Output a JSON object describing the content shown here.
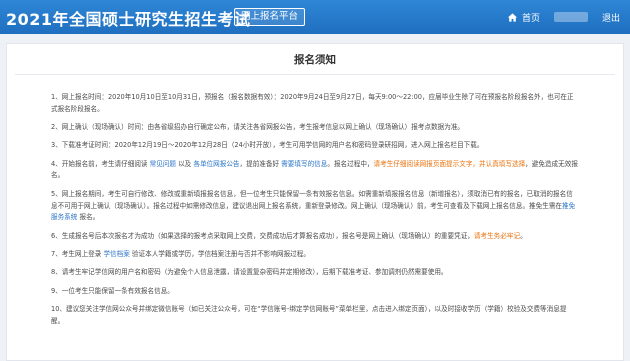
{
  "header": {
    "title": "2021年全国硕士研究生招生考试",
    "platform": "网上报名平台",
    "home_label": "首页",
    "logout_label": "退出"
  },
  "panel": {
    "title": "报名须知"
  },
  "notices": [
    {
      "parts": [
        {
          "text": "1、网上报名时间：2020年10月10日至10月31日，预报名（报名数据有效）：2020年9月24日至9月27日，每天9:00～22:00，应届毕业生除了可在预报名阶段报名外，也可在正式报名阶段报名。"
        }
      ]
    },
    {
      "parts": [
        {
          "text": "2、网上确认（现场确认）时间：由各省级招办自行确定公布，请关注各省网报公告，考生报考信息以网上确认（现场确认）报考点数据为准。"
        }
      ]
    },
    {
      "parts": [
        {
          "text": "3、下载准考证时间：2020年12月19日～2020年12月28日（24小时开放），考生可用学信网的用户名和密码登录研招网，进入网上报名栏目下载。"
        }
      ]
    },
    {
      "parts": [
        {
          "text": "4、开始报名前，考生请仔细阅读 "
        },
        {
          "text": "常见问题",
          "style": "blue"
        },
        {
          "text": " 以及 "
        },
        {
          "text": "各单位网报公告",
          "style": "blue"
        },
        {
          "text": "，提前准备好 "
        },
        {
          "text": "需要填写的信息",
          "style": "blue"
        },
        {
          "text": "。报名过程中，"
        },
        {
          "text": "请考生仔细阅读网报页面提示文字，并认真填写选择",
          "style": "orange"
        },
        {
          "text": "，避免造成无效报名。"
        }
      ]
    },
    {
      "parts": [
        {
          "text": "5、网上报名期间，考生可自行修改、修改或重新填报报名信息，但一位考生只能保留一条有效报名信息。如需重新填报报名信息（新增报名），须取消已有的报名，已取消的报名信息不可用于网上确认（现场确认）。报名过程中如需修改信息，建议退出网上报名系统，重新登录修改。网上确认（现场确认）前，考生可查看及下载网上报名信息。推免生需在"
        },
        {
          "text": "推免服务系统",
          "style": "blue"
        },
        {
          "text": " 报名。"
        }
      ]
    },
    {
      "parts": [
        {
          "text": "6、生成报名号后本次报名才为成功（如果选择的报考点采取网上交费，交费成功后才算报名成功），报名号是网上确认（现场确认）的重要凭证，"
        },
        {
          "text": "请考生务必牢记",
          "style": "orange"
        },
        {
          "text": "。"
        }
      ]
    },
    {
      "parts": [
        {
          "text": "7、考生网上登录 "
        },
        {
          "text": "学信档案",
          "style": "blue"
        },
        {
          "text": " 验证本人学籍或学历，学信档案注册与否并不影响网报过程。"
        }
      ]
    },
    {
      "parts": [
        {
          "text": "8、请考生牢记学信网的用户名和密码（为避免个人信息泄露，请设置复杂密码并定期修改），后期下载准考证、参加调剂仍然需要使用。"
        }
      ]
    },
    {
      "parts": [
        {
          "text": "9、一位考生只能保留一条有效报名信息。"
        }
      ]
    },
    {
      "parts": [
        {
          "text": "10、建议您关注学信网公众号并绑定微信账号（如已关注公众号，可在“学信账号-绑定学信网账号”菜单栏里，点击进入绑定页面），以及时接收学历（学籍）校验及交费等消息提醒。"
        }
      ]
    }
  ],
  "colors": {
    "header_bg": "#2376c9",
    "link_blue": "#2a75c8",
    "highlight_orange": "#e9710b"
  }
}
